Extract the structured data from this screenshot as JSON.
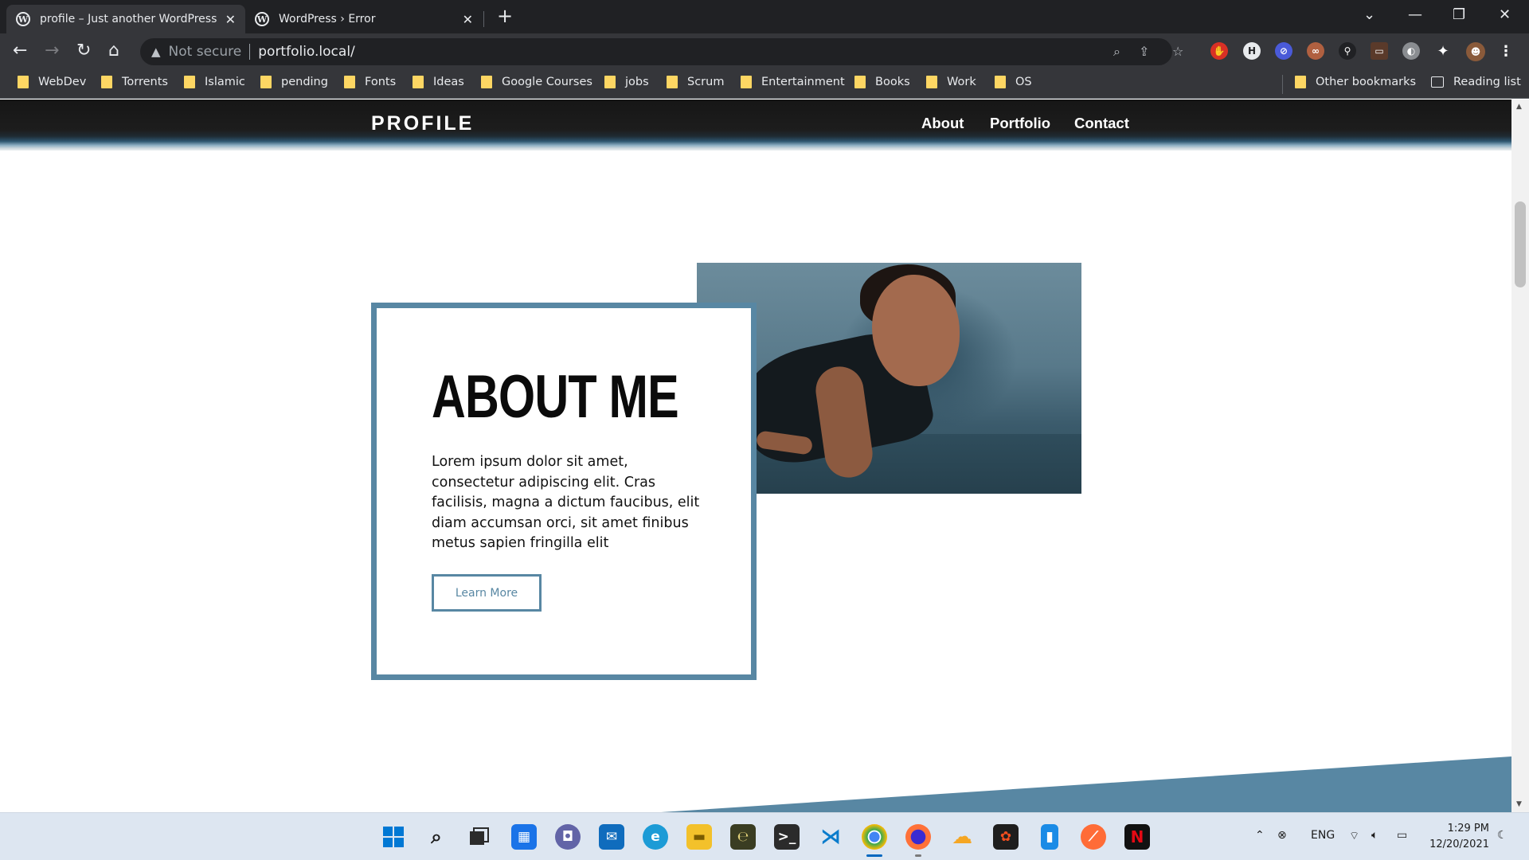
{
  "browser": {
    "tabs": [
      {
        "title": "profile – Just another WordPress",
        "active": true
      },
      {
        "title": "WordPress › Error",
        "active": false
      }
    ],
    "new_tab_symbol": "+",
    "window_controls": {
      "minimize": "—",
      "restore": "❐",
      "close": "✕",
      "tab_search": "⌄"
    },
    "nav": {
      "back": "←",
      "forward": "→",
      "reload": "↻",
      "home": "⌂"
    },
    "security_label": "Not secure",
    "url": "portfolio.local/",
    "omnibox_icons": [
      "zoom-icon",
      "share-icon",
      "star-icon"
    ],
    "extensions": [
      "adblock-icon",
      "extension-h-icon",
      "extension-block-icon",
      "extension-glasses-icon",
      "extension-key-icon",
      "extension-screen-icon",
      "extension-shield-icon",
      "puzzle-icon",
      "profile-avatar-icon",
      "kebab-menu-icon"
    ],
    "bookmarks": [
      "WebDev",
      "Torrents",
      "Islamic",
      "pending",
      "Fonts",
      "Ideas",
      "Google Courses",
      "jobs",
      "Scrum",
      "Entertainment",
      "Books",
      "Work",
      "OS"
    ],
    "other_bookmarks": "Other bookmarks",
    "reading_list": "Reading list"
  },
  "site": {
    "brand": "PROFILE",
    "nav": [
      "About",
      "Portfolio",
      "Contact"
    ],
    "about": {
      "title": "ABOUT ME",
      "body": "Lorem ipsum dolor sit amet, consectetur adipiscing elit. Cras facilisis, magna a dictum faucibus, elit diam accumsan orci, sit amet finibus metus sapien fringilla elit",
      "button": "Learn More"
    },
    "colors": {
      "accent": "#5887a3",
      "header_bg": "#161616",
      "text": "#0b0b0b"
    }
  },
  "taskbar": {
    "apps": [
      "windows-start-icon",
      "search-icon",
      "task-view-icon",
      "widgets-icon",
      "teams-chat-icon",
      "mail-icon",
      "edge-icon",
      "file-explorer-icon",
      "app-e-icon",
      "terminal-icon",
      "vscode-icon",
      "chrome-icon",
      "firefox-icon",
      "app-yellow-icon",
      "figma-icon",
      "app-blue-icon",
      "postman-icon",
      "netflix-icon"
    ],
    "tray": {
      "language": "ENG"
    },
    "time": "1:29 PM",
    "date": "12/20/2021"
  }
}
